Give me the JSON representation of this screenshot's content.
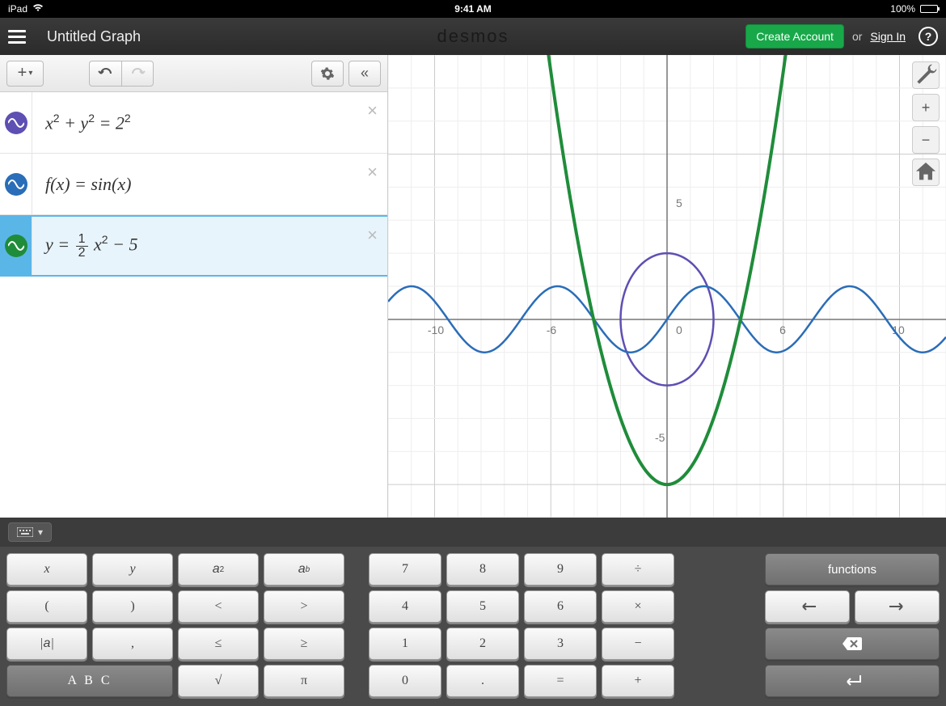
{
  "statusbar": {
    "device": "iPad",
    "time": "9:41 AM",
    "battery_pct": "100%"
  },
  "topbar": {
    "title": "Untitled Graph",
    "logo": "desmos",
    "create_account": "Create Account",
    "or": "or",
    "sign_in": "Sign In",
    "help": "?"
  },
  "sidebar_toolbar": {
    "add": "+",
    "collapse": "«"
  },
  "expressions": [
    {
      "color": "#5e4fb3",
      "label_html": "x<sup>2</sup> + y<sup>2</sup> = 2<sup>2</sup>",
      "selected": false
    },
    {
      "color": "#2a6db8",
      "label_html": "f(x) = sin(x)",
      "selected": false
    },
    {
      "color": "#1f8c3a",
      "label_html": "y = <span class='frac'><span class='n'>1</span><span class='d'>2</span></span> x<sup>2</sup> − 5",
      "selected": true
    }
  ],
  "graph": {
    "x_range": [
      -12,
      12
    ],
    "y_range": [
      -6,
      8
    ],
    "x_ticks": [
      -10,
      -5,
      0,
      5,
      10
    ],
    "y_ticks": [
      -5,
      5
    ],
    "tick_label_xm10": "-10",
    "tick_label_xm5": "-6",
    "tick_label_x0": "0",
    "tick_label_x5": "6",
    "tick_label_x10": "10",
    "tick_label_y5": "5",
    "tick_label_ym5": "-5"
  },
  "graph_controls": {
    "wrench": "",
    "plus": "+",
    "minus": "−",
    "home": "⌂"
  },
  "keyboard": {
    "group1": [
      "x",
      "y",
      "a²",
      "aᵇ",
      "(",
      ")",
      "<",
      ">",
      "|a|",
      ",",
      "≤",
      "≥",
      "A B C",
      "√",
      "π"
    ],
    "group2": [
      "7",
      "8",
      "9",
      "÷",
      "4",
      "5",
      "6",
      "×",
      "1",
      "2",
      "3",
      "−",
      "0",
      ".",
      "=",
      "+"
    ],
    "group3": {
      "functions": "functions",
      "left": "←",
      "right": "→",
      "backspace": "⌫",
      "enter": "↵"
    }
  },
  "chart_data": [
    {
      "type": "implicit-circle",
      "equation": "x^2 + y^2 = 4",
      "center": [
        0,
        0
      ],
      "radius": 2,
      "color": "#5e4fb3"
    },
    {
      "type": "line",
      "equation": "y = sin(x)",
      "x_range": [
        -12,
        12
      ],
      "color": "#2a6db8"
    },
    {
      "type": "line",
      "equation": "y = 0.5*x^2 - 5",
      "x_range": [
        -12,
        12
      ],
      "color": "#1f8c3a"
    }
  ]
}
